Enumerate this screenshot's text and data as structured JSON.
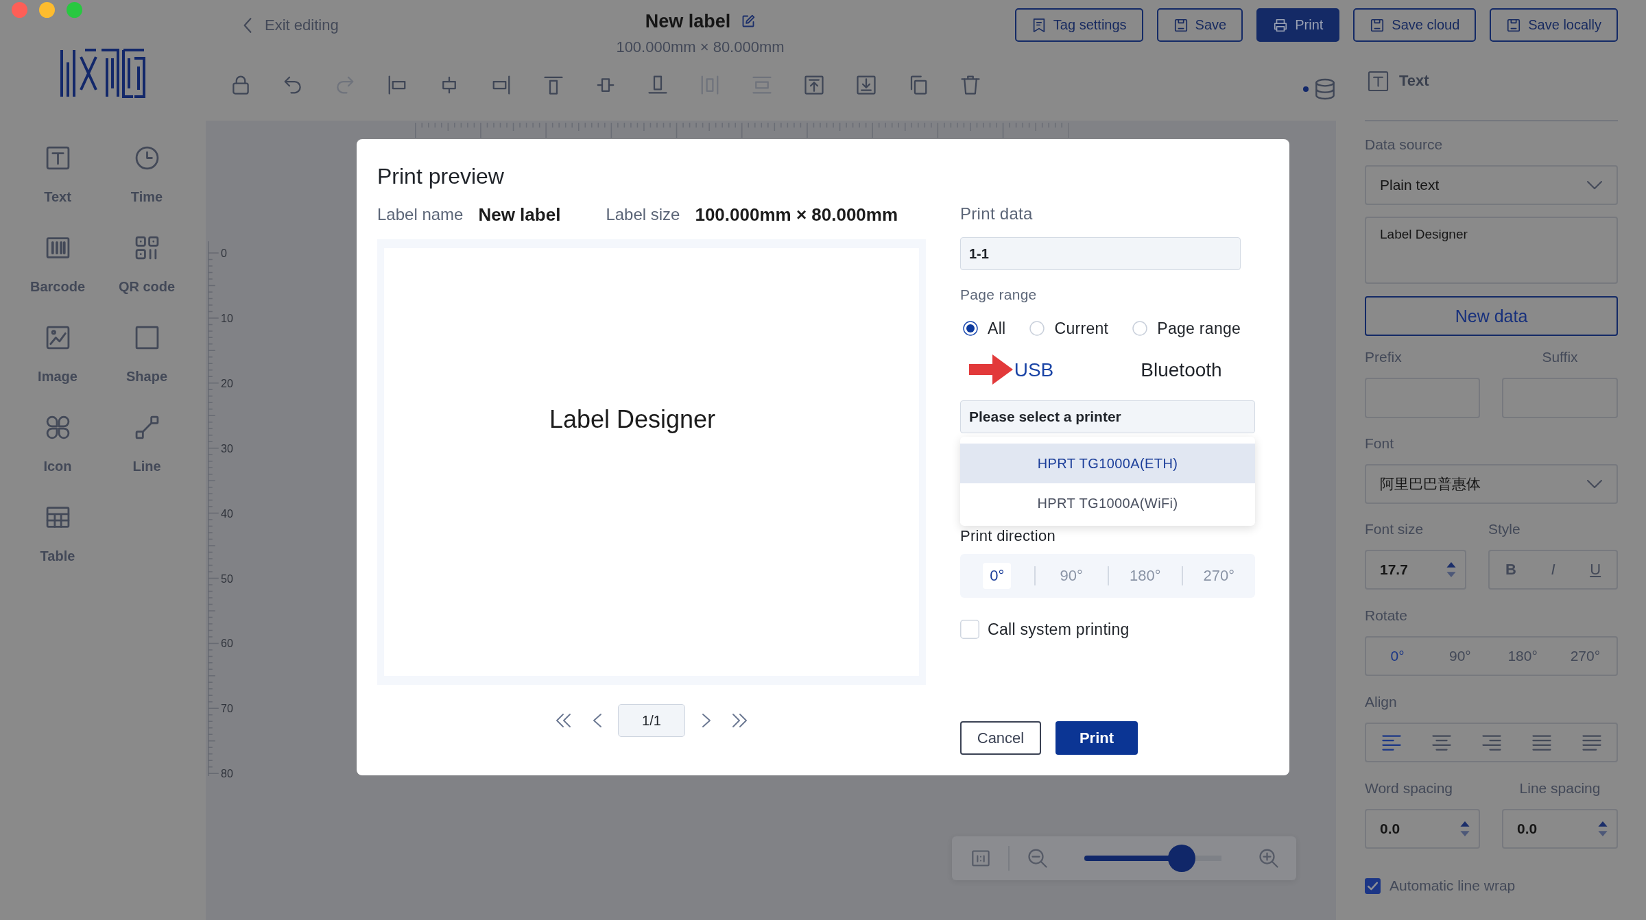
{
  "window": {
    "back_link": "Exit editing",
    "title": "New label",
    "subtitle": "100.000mm × 80.000mm",
    "buttons": [
      {
        "kind": "tag",
        "label": "Tag settings",
        "primary": false
      },
      {
        "kind": "save",
        "label": "Save",
        "primary": false
      },
      {
        "kind": "print",
        "label": "Print",
        "primary": true
      },
      {
        "kind": "save",
        "label": "Save cloud",
        "primary": false
      },
      {
        "kind": "save",
        "label": "Save locally",
        "primary": false
      }
    ]
  },
  "sidebar": {
    "items": [
      {
        "kind": "text",
        "label": "Text"
      },
      {
        "kind": "time",
        "label": "Time"
      },
      {
        "kind": "barcode",
        "label": "Barcode"
      },
      {
        "kind": "qrcode",
        "label": "QR code"
      },
      {
        "kind": "image",
        "label": "Image"
      },
      {
        "kind": "shape",
        "label": "Shape"
      },
      {
        "kind": "icon",
        "label": "Icon"
      },
      {
        "kind": "line",
        "label": "Line"
      },
      {
        "kind": "table",
        "label": "Table"
      }
    ]
  },
  "toolbar": {
    "tools": [
      {
        "kind": "lock",
        "disabled": false
      },
      {
        "kind": "undo",
        "disabled": false
      },
      {
        "kind": "redo",
        "disabled": true
      },
      {
        "kind": "align-left",
        "disabled": false
      },
      {
        "kind": "align-horizontal-center",
        "disabled": false
      },
      {
        "kind": "align-right",
        "disabled": false
      },
      {
        "kind": "align-top",
        "disabled": false
      },
      {
        "kind": "align-vertical-center",
        "disabled": false
      },
      {
        "kind": "align-bottom",
        "disabled": false
      },
      {
        "kind": "distribute-horizontal",
        "disabled": true
      },
      {
        "kind": "distribute-vertical",
        "disabled": true
      },
      {
        "kind": "bring-forward",
        "disabled": false
      },
      {
        "kind": "send-backward",
        "disabled": false
      },
      {
        "kind": "copy",
        "disabled": false
      },
      {
        "kind": "delete",
        "disabled": false
      }
    ]
  },
  "canvas": {
    "ruler_labels": [
      "0",
      "10",
      "20",
      "30",
      "40",
      "50",
      "60",
      "70",
      "80"
    ]
  },
  "print_dialog": {
    "title": "Print preview",
    "label_name": {
      "label": "Label name",
      "value": "New label"
    },
    "label_size": {
      "label": "Label size",
      "value": "100.000mm × 80.000mm"
    },
    "preview_text": "Label Designer",
    "page_indicator": "1/1",
    "print_data": {
      "label": "Print data",
      "value": "1-1"
    },
    "page_range": {
      "label": "Page range",
      "options": [
        {
          "label": "All",
          "selected": true
        },
        {
          "label": "Current",
          "selected": false
        },
        {
          "label": "Page range",
          "selected": false
        }
      ]
    },
    "connection_tabs": [
      {
        "label": "USB",
        "selected": true
      },
      {
        "label": "Bluetooth",
        "selected": false
      }
    ],
    "printer": {
      "placeholder": "Please select a printer",
      "expanded": true,
      "options": [
        {
          "label": "HPRT TG1000A(ETH)",
          "selected": true
        },
        {
          "label": "HPRT TG1000A(WiFi)",
          "selected": false
        }
      ]
    },
    "print_direction": {
      "label": "Print direction",
      "options": [
        {
          "label": "0°",
          "selected": true
        },
        {
          "label": "90°",
          "selected": false
        },
        {
          "label": "180°",
          "selected": false
        },
        {
          "label": "270°",
          "selected": false
        }
      ]
    },
    "system_printing": {
      "label": "Call system printing",
      "checked": false
    },
    "buttons": [
      {
        "label": "Cancel",
        "primary": false
      },
      {
        "label": "Print",
        "primary": true
      }
    ]
  },
  "zoom": {
    "level": 0.71
  },
  "properties": {
    "title": "Text",
    "data_source": {
      "label": "Data source",
      "value": "Plain text"
    },
    "content": "Label Designer",
    "new_data_button": "New data",
    "prefix": {
      "label": "Prefix"
    },
    "suffix": {
      "label": "Suffix"
    },
    "font": {
      "label": "Font",
      "value": "阿里巴巴普惠体"
    },
    "font_size": {
      "label": "Font size",
      "value": "17.7"
    },
    "style": {
      "label": "Style",
      "options": [
        {
          "kind": "bold",
          "label": "B"
        },
        {
          "kind": "italic",
          "label": "I"
        },
        {
          "kind": "underline",
          "label": "U"
        }
      ]
    },
    "rotate": {
      "label": "Rotate",
      "options": [
        {
          "label": "0°",
          "selected": true
        },
        {
          "label": "90°",
          "selected": false
        },
        {
          "label": "180°",
          "selected": false
        },
        {
          "label": "270°",
          "selected": false
        }
      ]
    },
    "align": {
      "label": "Align",
      "options": [
        {
          "kind": "left",
          "selected": true
        },
        {
          "kind": "center",
          "selected": false
        },
        {
          "kind": "right",
          "selected": false
        },
        {
          "kind": "justify",
          "selected": false
        },
        {
          "kind": "distributed",
          "selected": false
        }
      ]
    },
    "word_spacing": {
      "label": "Word spacing",
      "value": "0.0"
    },
    "line_spacing": {
      "label": "Line spacing",
      "value": "0.0"
    },
    "line_wrap": {
      "label": "Automatic line wrap",
      "checked": true
    }
  }
}
